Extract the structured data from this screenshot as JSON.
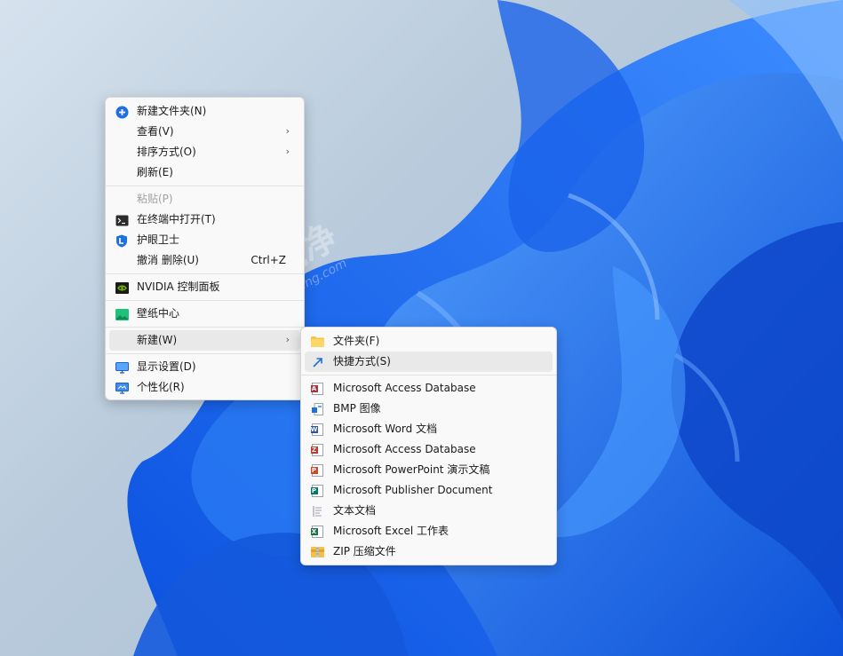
{
  "main_menu": {
    "items": [
      {
        "label": "新建文件夹(N)",
        "icon": "new-folder-plus-icon"
      },
      {
        "label": "查看(V)",
        "submenu": true
      },
      {
        "label": "排序方式(O)",
        "submenu": true
      },
      {
        "label": "刷新(E)"
      },
      {
        "label": "粘贴(P)",
        "disabled": true
      },
      {
        "label": "在终端中打开(T)",
        "icon": "terminal-icon"
      },
      {
        "label": "护眼卫士",
        "icon": "eye-guard-icon"
      },
      {
        "label": "撤消 删除(U)",
        "shortcut": "Ctrl+Z"
      },
      {
        "label": "NVIDIA 控制面板",
        "icon": "nvidia-icon"
      },
      {
        "label": "壁纸中心",
        "icon": "wallpaper-icon"
      },
      {
        "label": "新建(W)",
        "submenu": true,
        "active": true
      },
      {
        "label": "显示设置(D)",
        "icon": "display-icon"
      },
      {
        "label": "个性化(R)",
        "icon": "personalize-icon"
      }
    ]
  },
  "new_submenu": {
    "items": [
      {
        "label": "文件夹(F)",
        "icon": "folder-icon"
      },
      {
        "label": "快捷方式(S)",
        "icon": "shortcut-arrow-icon"
      },
      {
        "label": "Microsoft Access Database",
        "icon": "access-icon"
      },
      {
        "label": "BMP 图像",
        "icon": "bmp-icon"
      },
      {
        "label": "Microsoft Word 文档",
        "icon": "word-icon"
      },
      {
        "label": "Microsoft Access Database",
        "icon": "access-icon"
      },
      {
        "label": "Microsoft PowerPoint 演示文稿",
        "icon": "powerpoint-icon"
      },
      {
        "label": "Microsoft Publisher Document",
        "icon": "publisher-icon"
      },
      {
        "label": "文本文档",
        "icon": "text-doc-icon"
      },
      {
        "label": "Microsoft Excel 工作表",
        "icon": "excel-icon"
      },
      {
        "label": "ZIP 压缩文件",
        "icon": "zip-icon"
      }
    ]
  },
  "watermark": {
    "logo_text": "爱纯净",
    "logo_url_text": "aichunjing.com"
  },
  "colors": {
    "menu_bg": "#f9f9f9",
    "hover_bg": "#e9e9e9",
    "accent_blue": "#1f6fe0",
    "nvidia_green": "#76b900",
    "word_blue": "#2b579a",
    "excel_green": "#217346",
    "ppt_red": "#d24726",
    "access_red": "#a4373a",
    "publisher_teal": "#077568"
  }
}
